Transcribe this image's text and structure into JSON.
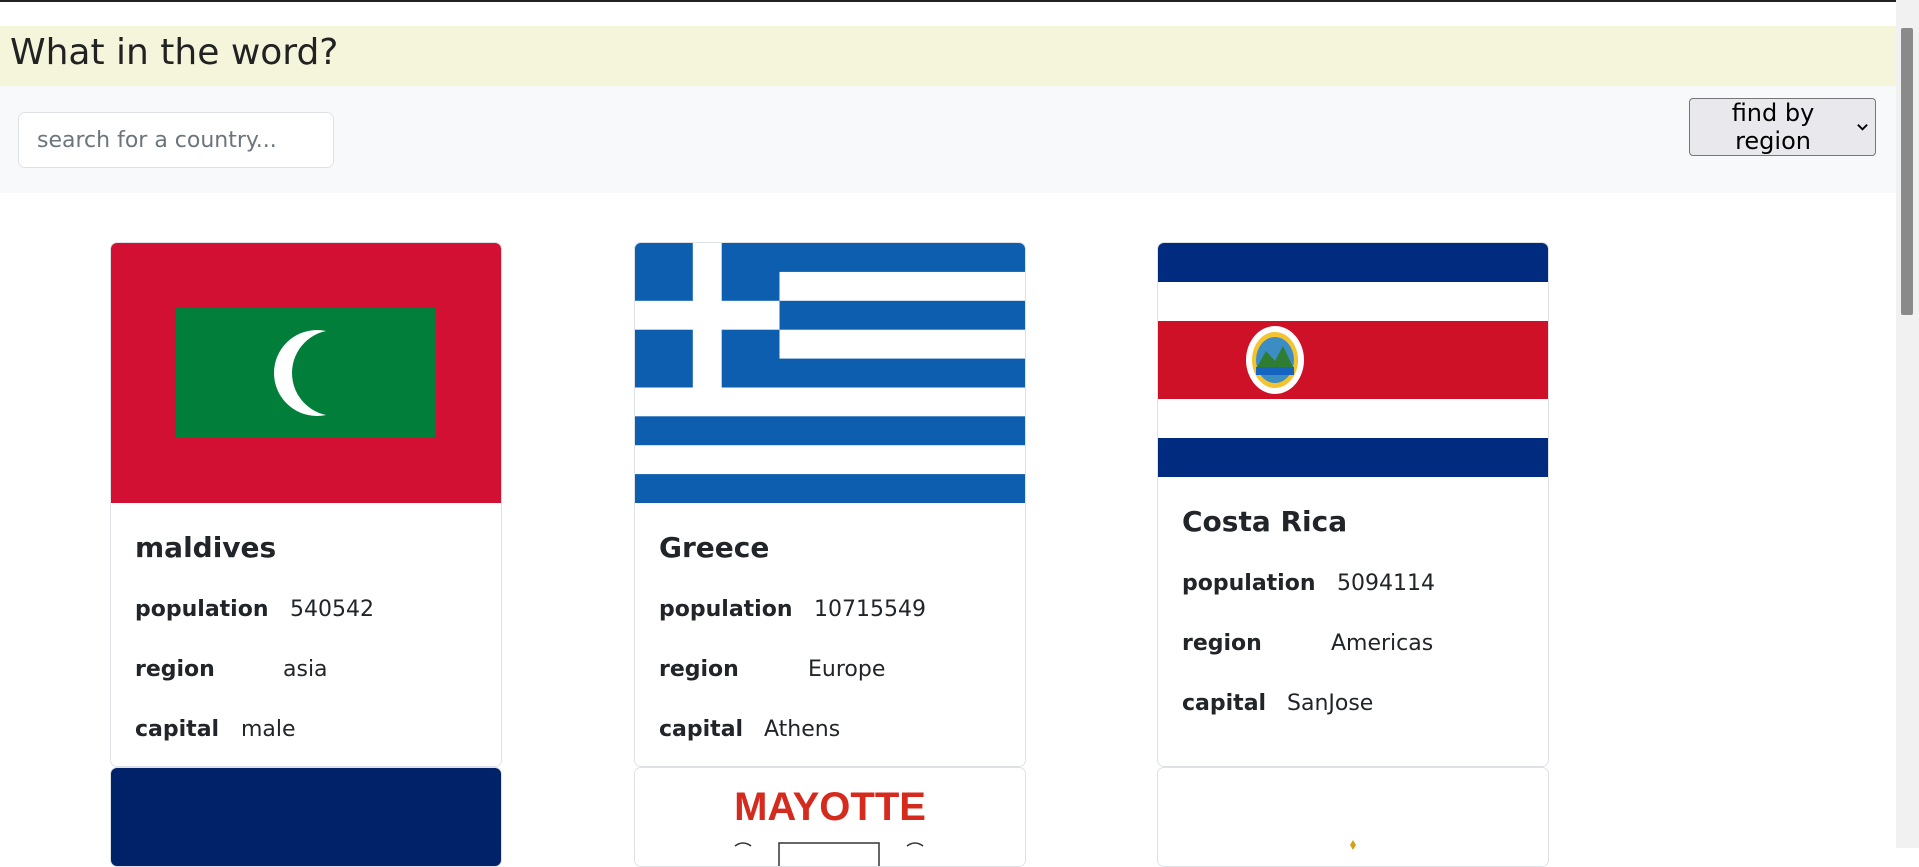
{
  "header": {
    "title": "What in the word?"
  },
  "search": {
    "placeholder": "search for a country..."
  },
  "region_filter": {
    "label": "find by region"
  },
  "labels": {
    "population": "population",
    "region": "region",
    "capital": "capital"
  },
  "countries": [
    {
      "name": "maldives",
      "population": "540542",
      "region": "asia",
      "capital": "male"
    },
    {
      "name": "Greece",
      "population": "10715549",
      "region": "Europe",
      "capital": "Athens"
    },
    {
      "name": "Costa Rica",
      "population": "5094114",
      "region": "Americas",
      "capital": "SanJose"
    }
  ],
  "partial_cards": {
    "mayotte_flag_text": "MAYOTTE"
  },
  "colors": {
    "header_bg": "#f5f5dc",
    "toolbar_bg": "#f8f9fa",
    "maldives_red": "#d21034",
    "maldives_green": "#007e3a",
    "greece_blue": "#0d5eaf",
    "costa_rica_blue": "#002b7f",
    "costa_rica_red": "#ce1126",
    "mayotte_red": "#d52b1e"
  }
}
